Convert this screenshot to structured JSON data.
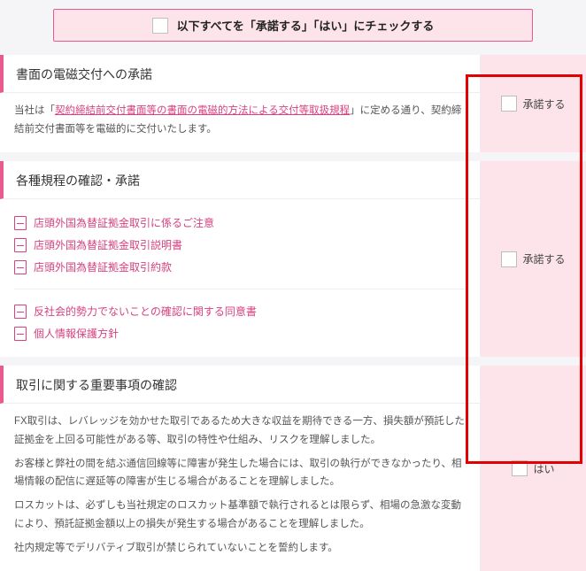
{
  "top_checkbox_label": "以下すべてを「承諾する」「はい」にチェックする",
  "confirm_labels": {
    "approve": "承諾する",
    "yes": "はい"
  },
  "sections": [
    {
      "title": "書面の電磁交付への承諾",
      "text_pre": "当社は「",
      "link": "契約締結前交付書面等の書面の電磁的方法による交付等取扱規程",
      "text_post": "」に定める通り、契約締結前交付書面等を電磁的に交付いたします。",
      "confirm": "approve"
    },
    {
      "title": "各種規程の確認・承諾",
      "docs_a": [
        "店頭外国為替証拠金取引に係るご注意",
        "店頭外国為替証拠金取引説明書",
        "店頭外国為替証拠金取引約款"
      ],
      "docs_b": [
        "反社会的勢力でないことの確認に関する同意書",
        "個人情報保護方針"
      ],
      "confirm": "approve"
    },
    {
      "title": "取引に関する重要事項の確認",
      "paragraphs": [
        "FX取引は、レバレッジを効かせた取引であるため大きな収益を期待できる一方、損失額が預託した証拠金を上回る可能性がある等、取引の特性や仕組み、リスクを理解しました。",
        "お客様と弊社の間を結ぶ通信回線等に障害が発生した場合には、取引の執行ができなかったり、相場情報の配信に遅延等の障害が生じる場合があることを理解しました。",
        "ロスカットは、必ずしも当社規定のロスカット基準額で執行されるとは限らず、相場の急激な変動により、預託証拠金額以上の損失が発生する場合があることを理解しました。",
        "社内規定等でデリバティブ取引が禁じられていないことを誓約します。"
      ],
      "confirm": "yes"
    }
  ]
}
